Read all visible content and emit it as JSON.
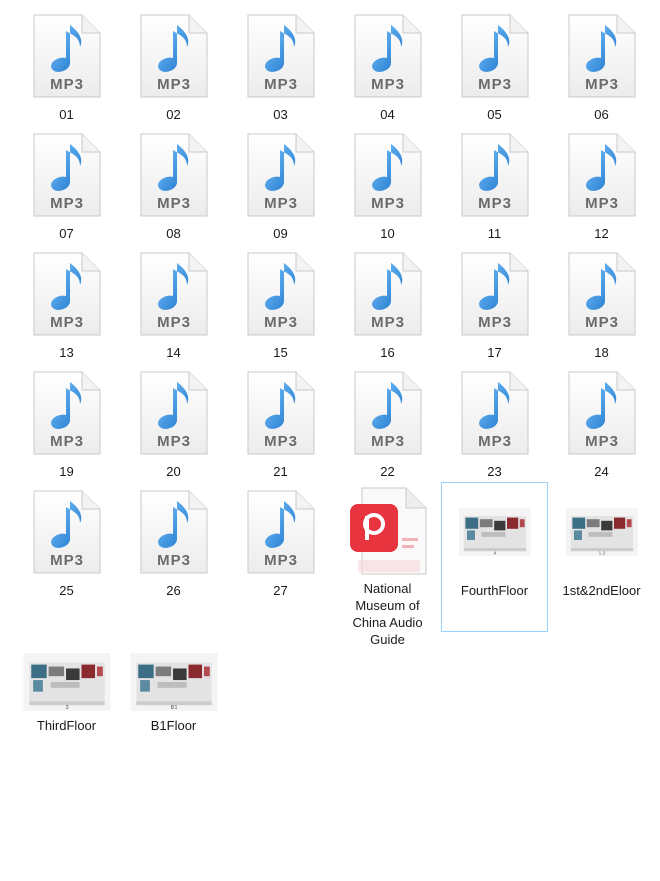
{
  "files": [
    {
      "name": "01",
      "type": "mp3"
    },
    {
      "name": "02",
      "type": "mp3"
    },
    {
      "name": "03",
      "type": "mp3"
    },
    {
      "name": "04",
      "type": "mp3"
    },
    {
      "name": "05",
      "type": "mp3"
    },
    {
      "name": "06",
      "type": "mp3"
    },
    {
      "name": "07",
      "type": "mp3"
    },
    {
      "name": "08",
      "type": "mp3"
    },
    {
      "name": "09",
      "type": "mp3"
    },
    {
      "name": "10",
      "type": "mp3"
    },
    {
      "name": "11",
      "type": "mp3"
    },
    {
      "name": "12",
      "type": "mp3"
    },
    {
      "name": "13",
      "type": "mp3"
    },
    {
      "name": "14",
      "type": "mp3"
    },
    {
      "name": "15",
      "type": "mp3"
    },
    {
      "name": "16",
      "type": "mp3"
    },
    {
      "name": "17",
      "type": "mp3"
    },
    {
      "name": "18",
      "type": "mp3"
    },
    {
      "name": "19",
      "type": "mp3"
    },
    {
      "name": "20",
      "type": "mp3"
    },
    {
      "name": "21",
      "type": "mp3"
    },
    {
      "name": "22",
      "type": "mp3"
    },
    {
      "name": "23",
      "type": "mp3"
    },
    {
      "name": "24",
      "type": "mp3"
    },
    {
      "name": "25",
      "type": "mp3"
    },
    {
      "name": "26",
      "type": "mp3"
    },
    {
      "name": "27",
      "type": "mp3"
    },
    {
      "name": "National Museum of China Audio Guide",
      "type": "pdf"
    },
    {
      "name": "FourthFloor",
      "type": "image",
      "selected": true,
      "floor_mark": "4"
    },
    {
      "name": "1st&2ndEloor",
      "type": "image",
      "floor_mark": "1 2"
    },
    {
      "name": "ThirdFloor",
      "type": "image",
      "floor_mark": "3"
    },
    {
      "name": "B1Floor",
      "type": "image",
      "floor_mark": "B1"
    }
  ],
  "icon_text": {
    "mp3": "MP3"
  },
  "colors": {
    "note_blue": "#2f8fe0",
    "pdf_red": "#e8343f",
    "selection_border": "#99d1ff"
  }
}
